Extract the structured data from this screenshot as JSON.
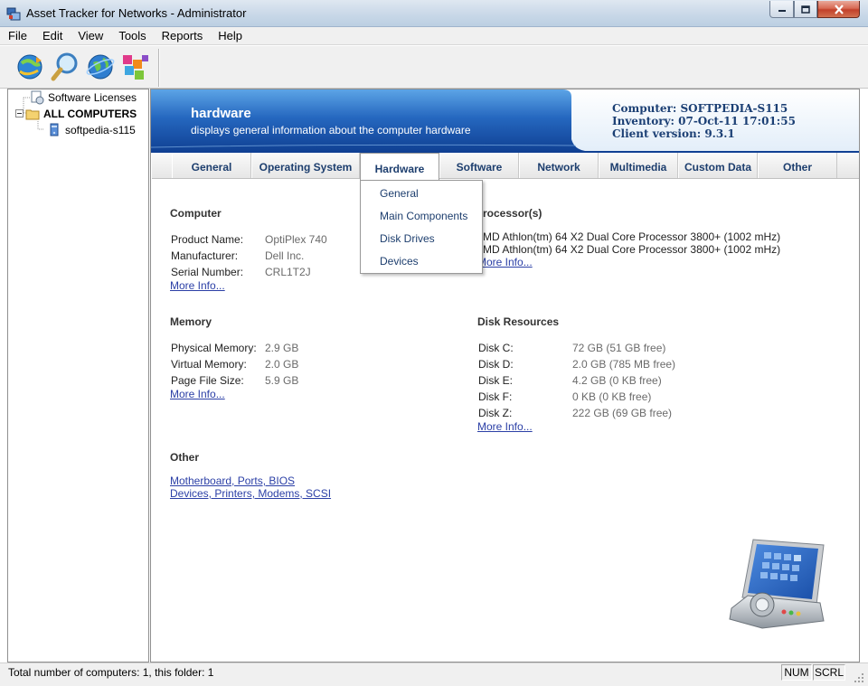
{
  "window": {
    "title": "Asset Tracker for Networks - Administrator"
  },
  "menu": [
    "File",
    "Edit",
    "View",
    "Tools",
    "Reports",
    "Help"
  ],
  "toolbar": {
    "buttons": [
      "refresh-globe-icon",
      "search-magnifier-icon",
      "internet-globe-icon",
      "report-cubes-icon"
    ]
  },
  "tree": {
    "items": [
      {
        "label": "Software Licenses",
        "icon": "licenses-icon"
      },
      {
        "label": "ALL COMPUTERS",
        "icon": "folder-icon"
      },
      {
        "label": "softpedia-s115",
        "icon": "computer-icon"
      }
    ]
  },
  "banner": {
    "title": "hardware",
    "subtitle": "displays general information about the computer hardware",
    "computer": "Computer: SOFTPEDIA-S115",
    "inventory": "Inventory: 07-Oct-11 17:01:55",
    "client_version": "Client version: 9.3.1"
  },
  "tabs": [
    "General",
    "Operating System",
    "Hardware",
    "Software",
    "Network",
    "Multimedia",
    "Custom Data",
    "Other"
  ],
  "active_tab": "Hardware",
  "dropdown": [
    "General",
    "Main Components",
    "Disk Drives",
    "Devices"
  ],
  "computer": {
    "heading": "Computer",
    "rows": [
      {
        "label": "Product Name:",
        "value": "OptiPlex 740"
      },
      {
        "label": "Manufacturer:",
        "value": "Dell Inc."
      },
      {
        "label": "Serial Number:",
        "value": "CRL1T2J"
      }
    ],
    "more": "More Info..."
  },
  "processor": {
    "heading": "Processor(s)",
    "lines": [
      "AMD Athlon(tm) 64 X2 Dual Core Processor 3800+ (1002 mHz)",
      "AMD Athlon(tm) 64 X2 Dual Core Processor 3800+ (1002 mHz)"
    ],
    "more": "More Info..."
  },
  "memory": {
    "heading": "Memory",
    "rows": [
      {
        "label": "Physical Memory:",
        "value": "2.9 GB"
      },
      {
        "label": "Virtual Memory:",
        "value": "2.0 GB"
      },
      {
        "label": "Page File Size:",
        "value": "5.9 GB"
      }
    ],
    "more": "More Info..."
  },
  "disks": {
    "heading": "Disk Resources",
    "rows": [
      {
        "label": "Disk C:",
        "value": "72 GB (51 GB free)"
      },
      {
        "label": "Disk D:",
        "value": "2.0 GB (785 MB free)"
      },
      {
        "label": "Disk E:",
        "value": "4.2 GB (0 KB free)"
      },
      {
        "label": "Disk F:",
        "value": "0 KB (0 KB free)"
      },
      {
        "label": "Disk Z:",
        "value": "222 GB (69 GB free)"
      }
    ],
    "more": "More Info..."
  },
  "other": {
    "heading": "Other",
    "links": [
      "Motherboard, Ports, BIOS",
      "Devices, Printers, Modems, SCSI"
    ]
  },
  "status": {
    "text": "Total number of computers: 1, this folder: 1",
    "num": "NUM",
    "scrl": "SCRL"
  },
  "colors": {
    "banner_blue": "#1e5fb4",
    "link": "#2b3fa6",
    "tab_text": "#1d3e6e"
  }
}
